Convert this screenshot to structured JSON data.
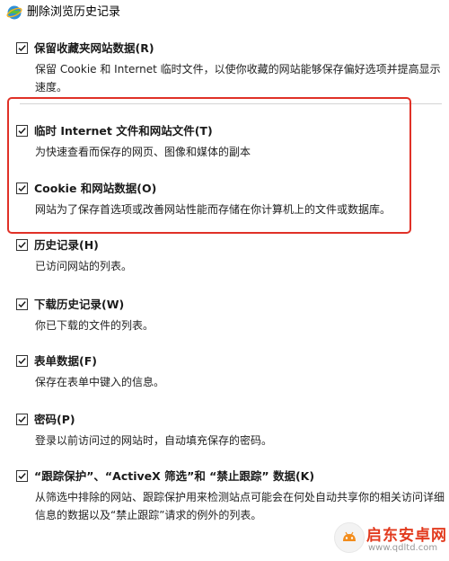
{
  "window": {
    "title": "删除浏览历史记录",
    "icon": "ie-globe-icon"
  },
  "options": [
    {
      "label": "保留收藏夹网站数据(R)",
      "desc": "保留 Cookie 和 Internet 临时文件，以使你收藏的网站能够保存偏好选项并提高显示速度。",
      "checked": true
    },
    {
      "label": "临时 Internet 文件和网站文件(T)",
      "desc": "为快速查看而保存的网页、图像和媒体的副本",
      "checked": true
    },
    {
      "label": "Cookie 和网站数据(O)",
      "desc": "网站为了保存首选项或改善网站性能而存储在你计算机上的文件或数据库。",
      "checked": true
    },
    {
      "label": "历史记录(H)",
      "desc": "已访问网站的列表。",
      "checked": true
    },
    {
      "label": "下载历史记录(W)",
      "desc": "你已下载的文件的列表。",
      "checked": true
    },
    {
      "label": "表单数据(F)",
      "desc": "保存在表单中键入的信息。",
      "checked": true
    },
    {
      "label": "密码(P)",
      "desc": "登录以前访问过的网站时，自动填充保存的密码。",
      "checked": true
    },
    {
      "label": "“跟踪保护”、“ActiveX 筛选”和 “禁止跟踪” 数据(K)",
      "desc": "从筛选中排除的网站、跟踪保护用来检测站点可能会在何处自动共享你的相关访问详细信息的数据以及“禁止跟踪”请求的例外的列表。",
      "checked": true
    }
  ],
  "annotation": {
    "color": "#e03127"
  },
  "watermark": {
    "text": "启东安卓网",
    "url": "www.qdltd.com"
  }
}
